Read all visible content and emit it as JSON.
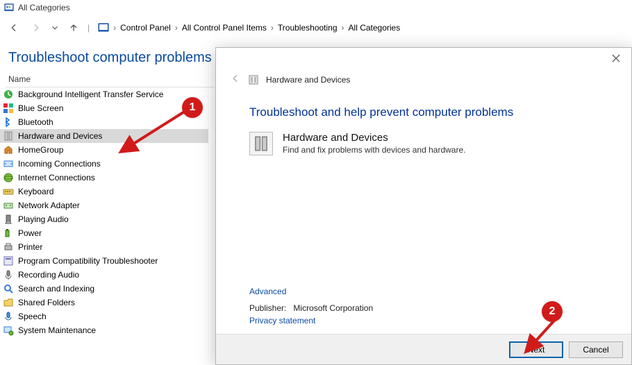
{
  "window": {
    "title": "All Categories"
  },
  "breadcrumb": [
    "Control Panel",
    "All Control Panel Items",
    "Troubleshooting",
    "All Categories"
  ],
  "page_heading": "Troubleshoot computer problems",
  "column_header": "Name",
  "items": [
    {
      "label": "Background Intelligent Transfer Service"
    },
    {
      "label": "Blue Screen"
    },
    {
      "label": "Bluetooth"
    },
    {
      "label": "Hardware and Devices",
      "selected": true
    },
    {
      "label": "HomeGroup"
    },
    {
      "label": "Incoming Connections"
    },
    {
      "label": "Internet Connections"
    },
    {
      "label": "Keyboard"
    },
    {
      "label": "Network Adapter"
    },
    {
      "label": "Playing Audio"
    },
    {
      "label": "Power"
    },
    {
      "label": "Printer"
    },
    {
      "label": "Program Compatibility Troubleshooter"
    },
    {
      "label": "Recording Audio"
    },
    {
      "label": "Search and Indexing"
    },
    {
      "label": "Shared Folders"
    },
    {
      "label": "Speech"
    },
    {
      "label": "System Maintenance"
    }
  ],
  "dialog": {
    "caption": "Hardware and Devices",
    "headline": "Troubleshoot and help prevent computer problems",
    "item_title": "Hardware and Devices",
    "item_sub": "Find and fix problems with devices and hardware.",
    "advanced": "Advanced",
    "publisher_label": "Publisher:",
    "publisher_value": "Microsoft Corporation",
    "privacy": "Privacy statement",
    "next": "Next",
    "cancel": "Cancel"
  },
  "annotations": {
    "step1": "1",
    "step2": "2"
  }
}
